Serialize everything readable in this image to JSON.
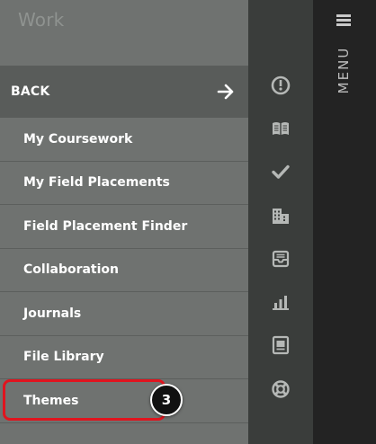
{
  "panel": {
    "title": "Work",
    "back_label": "BACK",
    "items": [
      {
        "label": "My Coursework"
      },
      {
        "label": "My Field Placements"
      },
      {
        "label": "Field Placement Finder"
      },
      {
        "label": "Collaboration"
      },
      {
        "label": "Journals"
      },
      {
        "label": "File Library"
      },
      {
        "label": "Themes"
      }
    ]
  },
  "annotation": {
    "step_number": "3",
    "highlight_color": "#e0141e"
  },
  "rail": {
    "icons": [
      "dashboard-icon",
      "book-icon",
      "checkmark-icon",
      "building-icon",
      "inbox-icon",
      "bar-chart-icon",
      "portfolio-icon",
      "lifebuoy-icon"
    ]
  },
  "menu": {
    "label": "MENU"
  },
  "colors": {
    "panel_bg": "#6f7270",
    "back_bg": "#595c5a",
    "rail_bg": "#3a3d3b",
    "menu_bg": "#232323",
    "rail_icon": "#b5b8b6"
  }
}
